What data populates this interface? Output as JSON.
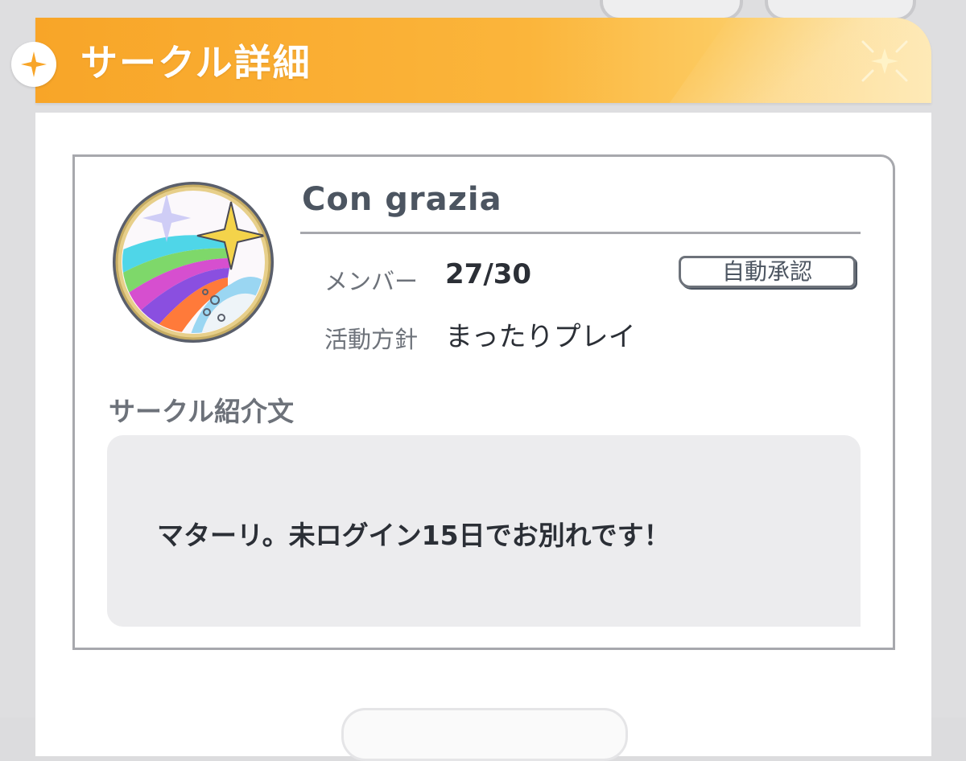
{
  "dialog": {
    "title": "サークル詳細"
  },
  "circle": {
    "name": "Con grazia",
    "member_label": "メンバー",
    "member_value": "27/30",
    "approval_badge": "自動承認",
    "policy_label": "活動方針",
    "policy_value": "まったりプレイ",
    "intro_label": "サークル紹介文",
    "intro_text": "マターリ。未ログイン15日でお別れです！"
  },
  "icons": {
    "emblem": "rainbow-star-wave-emblem-icon",
    "header_sparkle": "sparkle-icon",
    "side_badge": "sparkle-badge-icon"
  },
  "colors": {
    "header_orange": "#f8a528",
    "text_dark": "#2b2f36",
    "label_gray": "#6d727a"
  }
}
